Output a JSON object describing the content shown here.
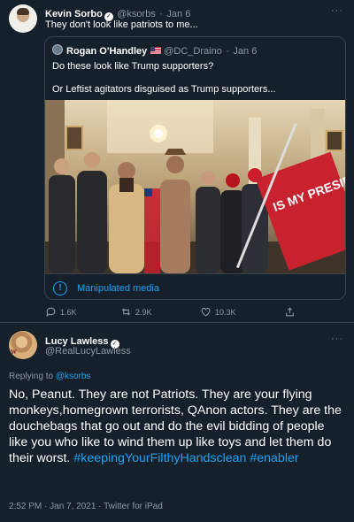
{
  "tweet": {
    "author_name": "Kevin Sorbo",
    "author_handle": "@ksorbs",
    "date": "Jan 6",
    "text": "They don't look like patriots to me...",
    "more": "···",
    "quoted": {
      "author_name": "Rogan O'Handley",
      "author_handle": "@DC_Draino",
      "date": "Jan 6",
      "line1": "Do these look like Trump supporters?",
      "line2": "Or Leftist agitators disguised as Trump supporters...",
      "photo_sign_text": "IS MY PRESIDENT",
      "notice": "Manipulated media"
    },
    "actions": {
      "replies": "1.6K",
      "retweets": "2.9K",
      "likes": "10.3K"
    }
  },
  "reply": {
    "author_name": "Lucy Lawless",
    "author_handle": "@RealLucyLawless",
    "replying_prefix": "Replying to ",
    "replying_to": "@ksorbs",
    "text": "No, Peanut. They are not Patriots. They are your flying monkeys,homegrown terrorists, QAnon actors. They are the douchebags that go out and do the evil bidding of people like you who like to wind them up like toys and let them do their worst.",
    "hashtags": [
      "#keepingYourFilthyHandsclean",
      "#enabler"
    ],
    "timestamp": "2:52 PM · Jan 7, 2021 · Twitter for iPad",
    "more": "···"
  },
  "colors": {
    "background": "#15202b",
    "accent": "#1da1f2",
    "muted": "#8899a6",
    "border": "#38444d"
  },
  "icons": [
    "verified-badge-icon",
    "us-flag-emoji",
    "info-icon",
    "reply-icon",
    "retweet-icon",
    "like-icon",
    "share-icon",
    "more-icon"
  ]
}
